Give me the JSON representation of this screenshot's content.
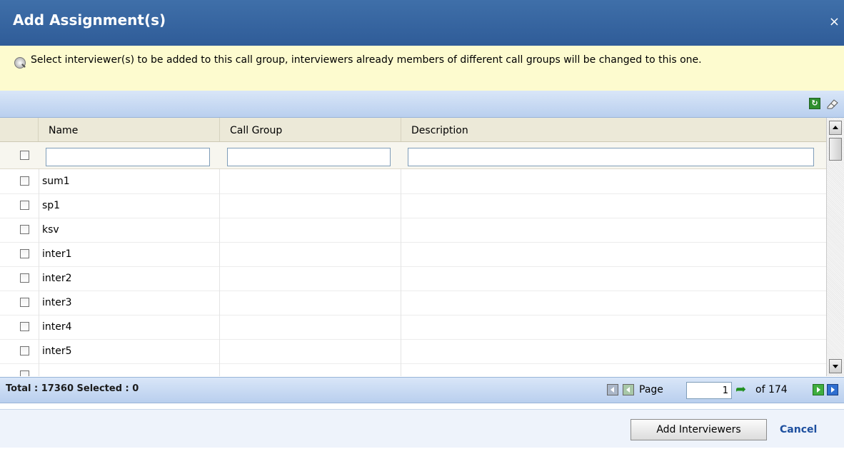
{
  "dialog": {
    "title": "Add Assignment(s)",
    "close_label": "×"
  },
  "info": {
    "icon": "info-magnifier-icon",
    "text": "Select interviewer(s) to be added to this call group, interviewers already members of different call groups will be changed to this one."
  },
  "toolbar": {
    "icons": [
      "refresh-icon",
      "eraser-icon"
    ]
  },
  "grid": {
    "columns": [
      {
        "label": "Name"
      },
      {
        "label": "Call Group"
      },
      {
        "label": "Description"
      }
    ],
    "filters": {
      "name": "",
      "call_group": "",
      "description": ""
    },
    "rows": [
      {
        "name": "sum1",
        "call_group": "",
        "description": ""
      },
      {
        "name": "sp1",
        "call_group": "",
        "description": ""
      },
      {
        "name": "ksv",
        "call_group": "",
        "description": ""
      },
      {
        "name": "inter1",
        "call_group": "",
        "description": ""
      },
      {
        "name": "inter2",
        "call_group": "",
        "description": ""
      },
      {
        "name": "inter3",
        "call_group": "",
        "description": ""
      },
      {
        "name": "inter4",
        "call_group": "",
        "description": ""
      },
      {
        "name": "inter5",
        "call_group": "",
        "description": ""
      }
    ]
  },
  "status": {
    "summary": "Total : 17360 Selected : 0",
    "page_label": "Page",
    "page_value": "1",
    "of_label": "of 174"
  },
  "footer": {
    "add_label": "Add Interviewers",
    "cancel_label": "Cancel"
  }
}
